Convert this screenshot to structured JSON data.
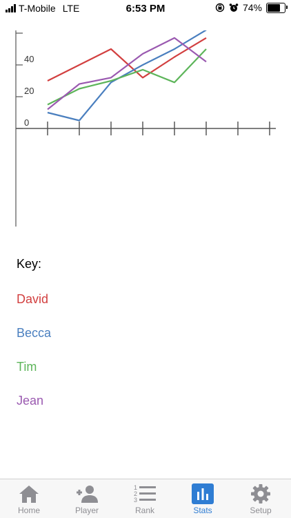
{
  "status_bar": {
    "carrier": "T-Mobile",
    "network": "LTE",
    "time": "6:53 PM",
    "battery": "74%",
    "battery_level": 0.74
  },
  "legend": {
    "title": "Key:",
    "items": [
      {
        "name": "David",
        "color": "#d23f3f"
      },
      {
        "name": "Becca",
        "color": "#4a7fbf"
      },
      {
        "name": "Tim",
        "color": "#5db55a"
      },
      {
        "name": "Jean",
        "color": "#9a59b0"
      }
    ]
  },
  "chart_data": {
    "type": "line",
    "x": [
      1,
      2,
      3,
      4,
      5,
      6
    ],
    "y_ticks": [
      "0",
      "20",
      "40",
      "60"
    ],
    "ylim": [
      -62,
      62
    ],
    "xlim": [
      0,
      8.2
    ],
    "grid": false,
    "series": [
      {
        "name": "David",
        "color": "#d23f3f",
        "values": [
          30,
          40,
          50,
          32,
          45,
          57
        ]
      },
      {
        "name": "Becca",
        "color": "#4a7fbf",
        "values": [
          10,
          5,
          29,
          40,
          50,
          62
        ]
      },
      {
        "name": "Tim",
        "color": "#5db55a",
        "values": [
          15,
          25,
          30,
          37,
          29,
          50
        ]
      },
      {
        "name": "Jean",
        "color": "#9a59b0",
        "values": [
          12,
          28,
          32,
          47,
          57,
          42
        ]
      }
    ]
  },
  "tabs": [
    {
      "label": "Home",
      "icon": "home-icon",
      "active": false
    },
    {
      "label": "Player",
      "icon": "add-player-icon",
      "active": false
    },
    {
      "label": "Rank",
      "icon": "rank-list-icon",
      "active": false
    },
    {
      "label": "Stats",
      "icon": "stats-icon",
      "active": true
    },
    {
      "label": "Setup",
      "icon": "gear-icon",
      "active": false
    }
  ]
}
